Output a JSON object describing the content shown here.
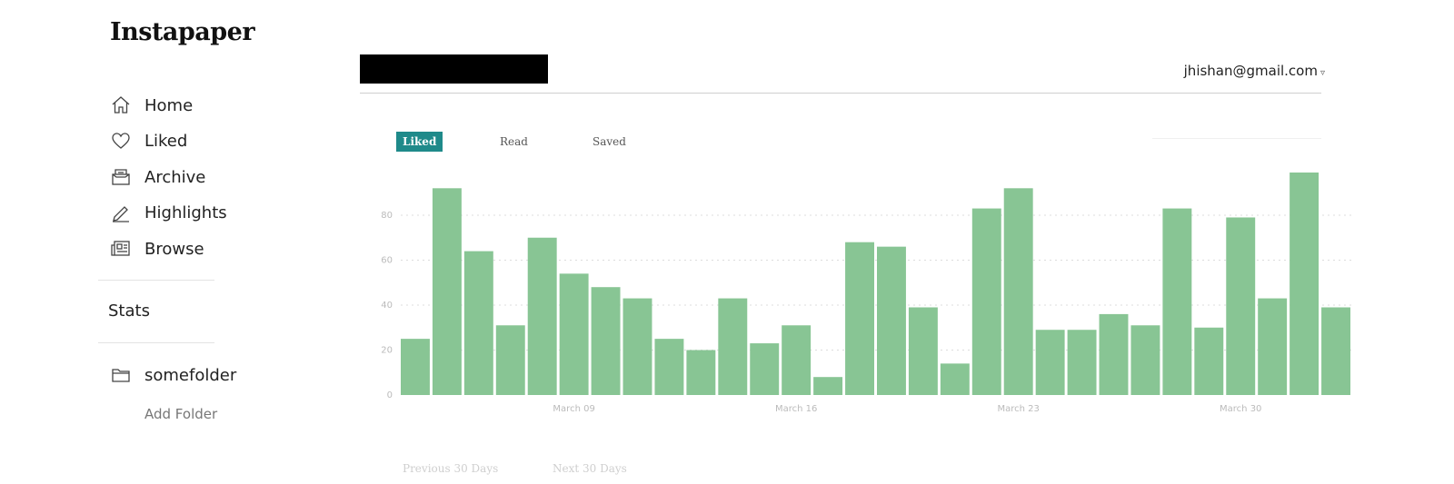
{
  "app": {
    "logo": "Instapaper"
  },
  "sidebar": {
    "items": [
      {
        "label": "Home",
        "icon": "home-icon"
      },
      {
        "label": "Liked",
        "icon": "heart-icon"
      },
      {
        "label": "Archive",
        "icon": "archive-icon"
      },
      {
        "label": "Highlights",
        "icon": "pen-icon"
      },
      {
        "label": "Browse",
        "icon": "newspaper-icon"
      }
    ],
    "stats_label": "Stats",
    "folder": {
      "label": "somefolder",
      "icon": "folder-icon"
    },
    "add_folder": "Add Folder"
  },
  "header": {
    "account": "jhishan@gmail.com",
    "account_caret": "▿"
  },
  "tabs": [
    {
      "label": "Liked",
      "active": true
    },
    {
      "label": "Read",
      "active": false
    },
    {
      "label": "Saved",
      "active": false
    }
  ],
  "colors": {
    "bar": "#88c594",
    "active_tab": "#1f8a8a"
  },
  "chart_data": {
    "type": "bar",
    "values": [
      25,
      92,
      64,
      31,
      70,
      54,
      48,
      43,
      25,
      20,
      43,
      23,
      31,
      8,
      68,
      66,
      39,
      14,
      83,
      92,
      29,
      29,
      36,
      31,
      83,
      30,
      79,
      43,
      99,
      39
    ],
    "y_ticks": [
      0,
      20,
      40,
      60,
      80
    ],
    "ylim": [
      0,
      100
    ],
    "x_tick_labels": [
      {
        "index": 5,
        "label": "March 09"
      },
      {
        "index": 12,
        "label": "March 16"
      },
      {
        "index": 19,
        "label": "March 23"
      },
      {
        "index": 26,
        "label": "March 30"
      }
    ],
    "grid": true
  },
  "pager": {
    "previous": "Previous 30 Days",
    "next": "Next 30 Days"
  }
}
